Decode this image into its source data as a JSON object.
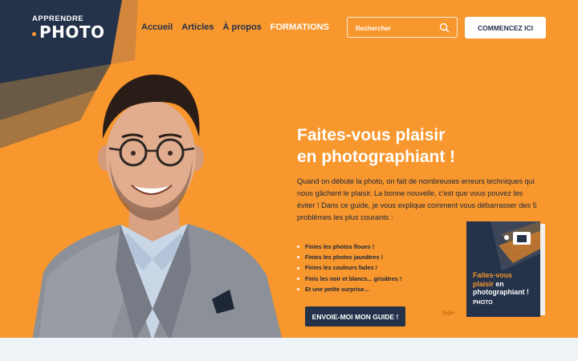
{
  "brand": {
    "logo_top": "APPRENDRE",
    "logo_bottom": "PHOTO"
  },
  "nav": {
    "items": [
      {
        "label": "Accueil"
      },
      {
        "label": "Articles"
      },
      {
        "label": "À propos"
      },
      {
        "label": "FORMATIONS"
      }
    ]
  },
  "search": {
    "placeholder": "Rechercher"
  },
  "header_cta": {
    "label": "COMMENCEZ ICI"
  },
  "hero": {
    "title_line1": "Faites-vous plaisir",
    "title_line2": "en photographiant !",
    "intro": "Quand on débute la photo, on fait de nombreuses erreurs techniques qui nous gâchent le plaisir. La bonne nouvelle, c'est que vous pouvez les éviter ! Dans ce guide, je vous explique comment vous débarrasser des 5 problèmes les plus courants :",
    "bullets": [
      "Finies les photos floues !",
      "Finies les photos jaunâtres !",
      "Finies les couleurs fades !",
      "Finis les noir et blancs... grisâtres !",
      "Et une petite surprise..."
    ],
    "button_label": "ENVOIE-MOI MON GUIDE !"
  },
  "book": {
    "title_line1": "Faites-vous",
    "title_line2a": "plaisir",
    "title_line2b": " en",
    "title_line3": "photographiant !",
    "logo": "PHOTO"
  },
  "colors": {
    "accent_orange": "#f7972e",
    "navy": "#24324a"
  }
}
